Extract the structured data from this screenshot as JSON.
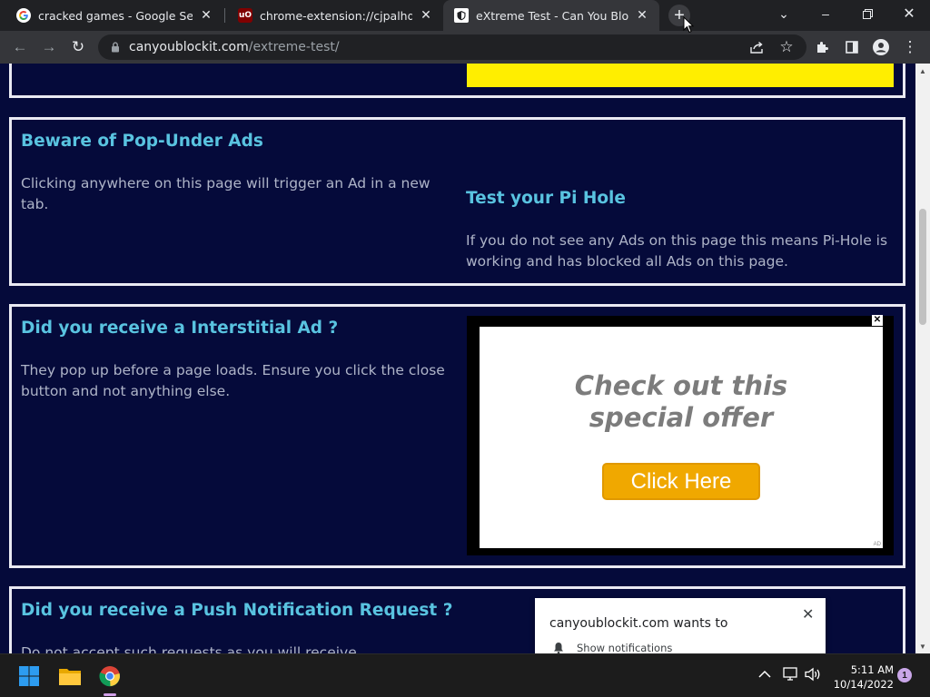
{
  "tabs": [
    {
      "title": "cracked games - Google Search",
      "favicon": "google-icon"
    },
    {
      "title": "chrome-extension://cjpalhdlnbpa",
      "favicon": "ublock-icon"
    },
    {
      "title": "eXtreme Test - Can You Block It ?",
      "favicon": "site-icon"
    }
  ],
  "toolbar": {
    "url_host": "canyoublockit.com",
    "url_path": "/extreme-test/"
  },
  "page": {
    "popunder": {
      "heading": "Beware of Pop-Under Ads",
      "text": "Clicking anywhere on this page will trigger an Ad in a new tab.",
      "pihole_heading": "Test your Pi Hole",
      "pihole_text": "If you do not see any Ads on this page this means Pi-Hole is working and has blocked all Ads on this page."
    },
    "interstitial": {
      "heading": "Did you receive a Interstitial Ad ?",
      "text": "They pop up before a page loads. Ensure you click the close button and not anything else.",
      "ad_line1": "Check out this",
      "ad_line2": "special offer",
      "ad_button": "Click Here",
      "ad_tag": "AD"
    },
    "push": {
      "heading": "Did you receive a Push Notification Request ?",
      "text": "Do not accept such requests as you will receive"
    }
  },
  "notification": {
    "title": "canyoublockit.com wants to",
    "option": "Show notifications"
  },
  "taskbar": {
    "time": "5:11 AM",
    "date": "10/14/2022",
    "notification_count": "1"
  },
  "colors": {
    "page_bg": "#050a3a",
    "heading": "#59c3e0",
    "ad_yellow": "#ffee00",
    "cta_orange": "#f0a800"
  }
}
